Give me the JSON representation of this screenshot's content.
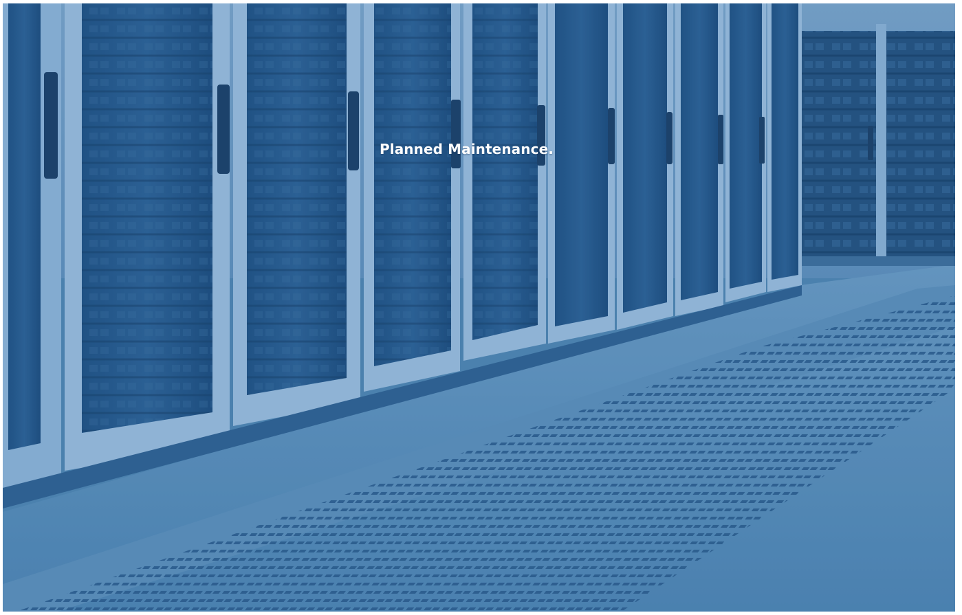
{
  "hero": {
    "background_image": "server-room",
    "tint_color": "#2f6fa6",
    "headline": "Planned Maintenance."
  }
}
